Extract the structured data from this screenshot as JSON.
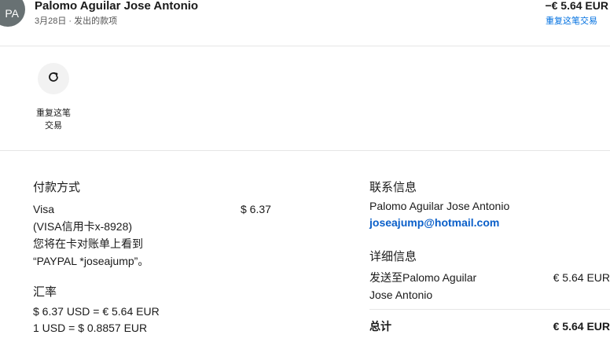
{
  "header": {
    "avatar_initials": "PA",
    "name": "Palomo Aguilar Jose Antonio",
    "subtitle": "3月28日 · 发出的款项",
    "amount": "−€ 5.64 EUR",
    "repeat_link": "重复这笔交易"
  },
  "action": {
    "icon": "refresh-icon",
    "label": "重复这笔交易"
  },
  "payment": {
    "title": "付款方式",
    "lines": [
      "Visa",
      "(VISA信用卡x-8928)",
      "您将在卡对账单上看到",
      "“PAYPAL *joseajump”。"
    ],
    "amount": "$ 6.37"
  },
  "exchange": {
    "title": "汇率",
    "lines": [
      "$ 6.37 USD = € 5.64 EUR",
      "1 USD = $ 0.8857 EUR"
    ]
  },
  "contact": {
    "title": "联系信息",
    "name": "Palomo Aguilar Jose Antonio",
    "email": "joseajump@hotmail.com"
  },
  "details": {
    "title": "详细信息",
    "sent_to_lines": [
      "发送至Palomo Aguilar",
      "Jose Antonio"
    ],
    "sent_amount": "€ 5.64 EUR",
    "total_label": "总计",
    "total_amount": "€ 5.64 EUR"
  },
  "colors": {
    "link": "#0070e0",
    "email": "#0a5fc9",
    "avatar": "#687173"
  }
}
